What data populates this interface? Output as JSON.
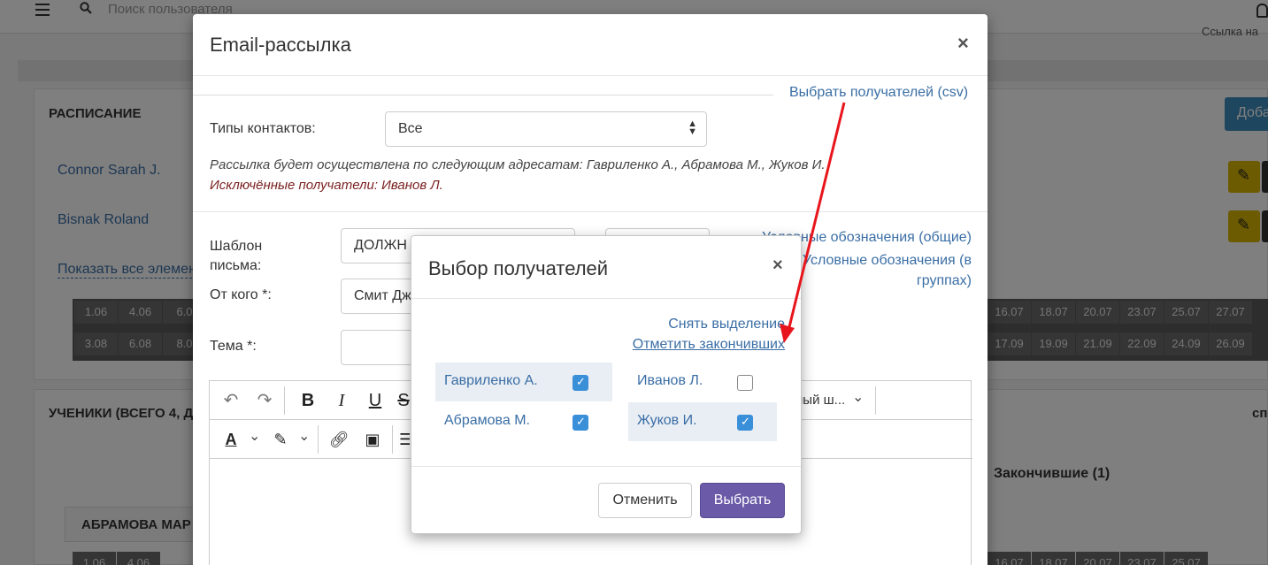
{
  "background": {
    "search_placeholder": "Поиск пользователя",
    "corner_link": "Ссылка на",
    "schedule_title": "РАСПИСАНИЕ",
    "people": [
      "Connor Sarah J.",
      "Bisnak Roland"
    ],
    "show_all_link": "Показать все элемен",
    "add_button": "Доба",
    "dates_row1_left": [
      "1.06",
      "4.06",
      "6.0"
    ],
    "dates_row2_left": [
      "3.08",
      "6.08",
      "8.0"
    ],
    "dates_row1_right": [
      "16.07",
      "18.07",
      "20.07",
      "23.07",
      "25.07",
      "27.07"
    ],
    "dates_row2_right": [
      "17.09",
      "19.09",
      "21.09",
      "22.09",
      "24.09",
      "26.09"
    ],
    "students_title": "УЧЕНИКИ (ВСЕГО 4, Д",
    "students_right": "спи",
    "finished_tab": "Закончившие (1)",
    "student_name": "АБРАМОВА МАР",
    "dates_row3_left": [
      "1.06",
      "4.06"
    ],
    "dates_row3_right": [
      "16.07",
      "18.07",
      "20.07",
      "23.07",
      "25.07"
    ]
  },
  "modal": {
    "title": "Email-рассылка",
    "close": "×",
    "csv_link": "Выбрать получателей (csv)",
    "contact_types_label": "Типы контактов:",
    "contact_types_value": "Все",
    "recipients_note": "Рассылка будет осуществлена по следующим адресатам: Гавриленко А., Абрамова М., Жуков И.",
    "excluded_note": "Исключённые получатели: Иванов Л.",
    "template_label_line1": "Шаблон",
    "template_label_line2": "письма:",
    "template_value": "ДОЛЖН",
    "from_label": "От кого *:",
    "from_value": "Смит Дж",
    "subject_label": "Тема *:",
    "legend_general": "Условные обозначения (общие)",
    "legend_groups_line1": "Условные обозначения (в",
    "legend_groups_line2": "группах)",
    "font_select_value": "ный ш..."
  },
  "recipients": {
    "title": "Выбор получателей",
    "close": "×",
    "clear_selection": "Снять выделение",
    "mark_finished": "Отметить закончивших",
    "people": [
      {
        "name": "Гавриленко А.",
        "checked": true
      },
      {
        "name": "Иванов Л.",
        "checked": false
      },
      {
        "name": "Абрамова М.",
        "checked": true
      },
      {
        "name": "Жуков И.",
        "checked": true
      }
    ],
    "cancel_button": "Отменить",
    "select_button": "Выбрать"
  },
  "colors": {
    "link": "#3a6ea5",
    "excluded_text": "#7a1f1f",
    "primary_button": "#6a5aa8",
    "checkbox": "#3a8fd9",
    "annotation_arrow": "#e8161c"
  }
}
